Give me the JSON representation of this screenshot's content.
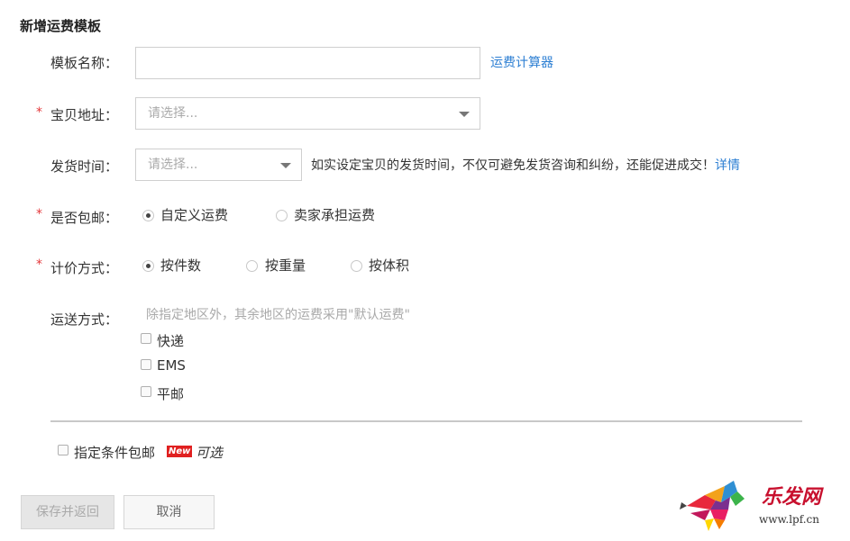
{
  "page_title": "新增运费模板",
  "required_mark": "*",
  "form": {
    "template_name": {
      "label": "模板名称：",
      "value": "",
      "calculator_link": "运费计算器"
    },
    "item_address": {
      "label": "宝贝地址：",
      "placeholder": "请选择..."
    },
    "ship_time": {
      "label": "发货时间：",
      "placeholder": "请选择...",
      "hint": "如实设定宝贝的发货时间，不仅可避免发货咨询和纠纷，还能促进成交！",
      "detail_link": "详情"
    },
    "free_shipping": {
      "label": "是否包邮：",
      "options": [
        "自定义运费",
        "卖家承担运费"
      ],
      "selected": "自定义运费"
    },
    "pricing_method": {
      "label": "计价方式：",
      "options": [
        "按件数",
        "按重量",
        "按体积"
      ],
      "selected": "按件数"
    },
    "delivery_method": {
      "label": "运送方式：",
      "hint": "除指定地区外，其余地区的运费采用\"默认运费\"",
      "options": [
        "快递",
        "EMS",
        "平邮"
      ]
    },
    "conditional_free": {
      "label": "指定条件包邮",
      "badge": "New",
      "optional": "可选"
    }
  },
  "buttons": {
    "save": "保存并返回",
    "cancel": "取消"
  },
  "watermark": {
    "name": "乐发网",
    "url": "www.lpf.cn"
  },
  "colors": {
    "link": "#2d7fd3",
    "required": "#e4393c",
    "badge": "#e02020"
  }
}
